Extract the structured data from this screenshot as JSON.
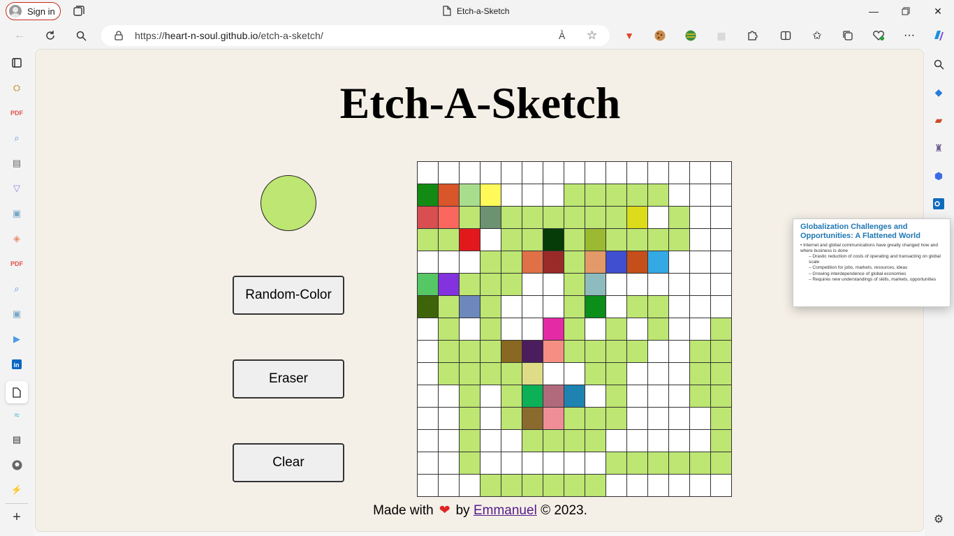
{
  "browser": {
    "signin_label": "Sign in",
    "tab_title": "Etch-a-Sketch",
    "url_prefix": "https://",
    "url_host": "heart-n-soul.github.io",
    "url_path": "/etch-a-sketch/"
  },
  "page": {
    "heading": "Etch-A-Sketch",
    "current_color": "#bde672",
    "buttons": {
      "random": "Random-Color",
      "eraser": "Eraser",
      "clear": "Clear"
    },
    "footer": {
      "made_with": "Made with",
      "heart": "❤",
      "by": "by",
      "author": "Emmanuel",
      "copyright": "© 2023."
    }
  },
  "popup": {
    "title": "Globalization Challenges and Opportunities: A Flattened World",
    "bullet": "• Internet and global communications have greatly changed how and where business is done",
    "subs": [
      "– Drastic reduction of costs of operating and transacting on global scale",
      "– Competition for jobs, markets, resources, ideas",
      "– Growing interdependence of global economies",
      "– Requires new understandings of skills, markets, opportunities"
    ]
  },
  "grid": {
    "size": 15,
    "palette": {
      "W": "#ffffff",
      "G": "#bde672",
      "a": "#138a13",
      "b": "#d9552a",
      "c": "#a9dd8e",
      "d": "#88a064",
      "e": "#fffa5a",
      "f": "#d94e50",
      "g": "#fb675e",
      "h": "#6d9272",
      "i": "#dcdc1a",
      "j": "#e3181d",
      "k": "#053c08",
      "l": "#9bba32",
      "m": "#e07048",
      "n": "#9a2a28",
      "o": "#e39a68",
      "p": "#404ed0",
      "q": "#c44f1a",
      "r": "#34a9e3",
      "s": "#55c764",
      "t": "#8332e0",
      "u": "#8ebcbe",
      "v": "#3e6409",
      "w": "#6c88bc",
      "x": "#0b8e1a",
      "y": "#e42aa4",
      "z": "#896821",
      "A": "#4c1d5e",
      "B": "#f58f84",
      "C": "#dfdc88",
      "D": "#0bb057",
      "E": "#b06a7c",
      "F": "#1f83b2",
      "H": "#8b6a2e",
      "I": "#ef8e97"
    },
    "rows": [
      "WWWWWWWWWWWWWWW",
      "abceWWWGGGGGWWW",
      "fgGhGGGGGGiWGWW",
      "GGjWGGkGlGGGGWW",
      "WWWGGmnGopqrWWW",
      "stGGGWWGuWWWWWW",
      "vGwGWWWGxWGGWWW",
      "WGWGWWyGWGWGWWG",
      "WGGGzABGGGGWWGG",
      "WGGGGCWWGGWWWGG",
      "WWGWGDEFWGWWWGG",
      "WWGWGHIGGGWWWWG",
      "WWGWWGGGGWWWWWG",
      "WWGWWWWWWGGGGGG",
      "WWWGGGGGGWWWWWW"
    ]
  }
}
